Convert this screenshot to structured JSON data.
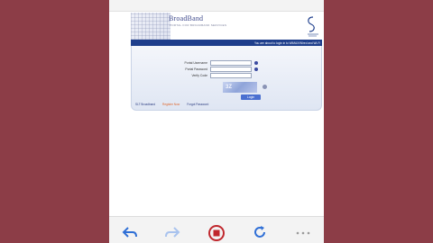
{
  "header": {
    "brand_title": "BroadBand",
    "brand_sub": "PORTAL FOR BROADBAND SERVICES",
    "band_text": "You are about to login in to WiMAX/Wired and Wi-Fi"
  },
  "form": {
    "username_label": "Portal Username",
    "password_label": "Portal Password",
    "verify_label": "Verify Code",
    "captcha_text": "3Z",
    "login_label": "Login"
  },
  "links": {
    "link1": "SLT Broadband",
    "link2": "Register Now",
    "link3": "Forgot Password"
  },
  "colors": {
    "accent": "#1e3e8c",
    "stop": "#c0272d"
  }
}
